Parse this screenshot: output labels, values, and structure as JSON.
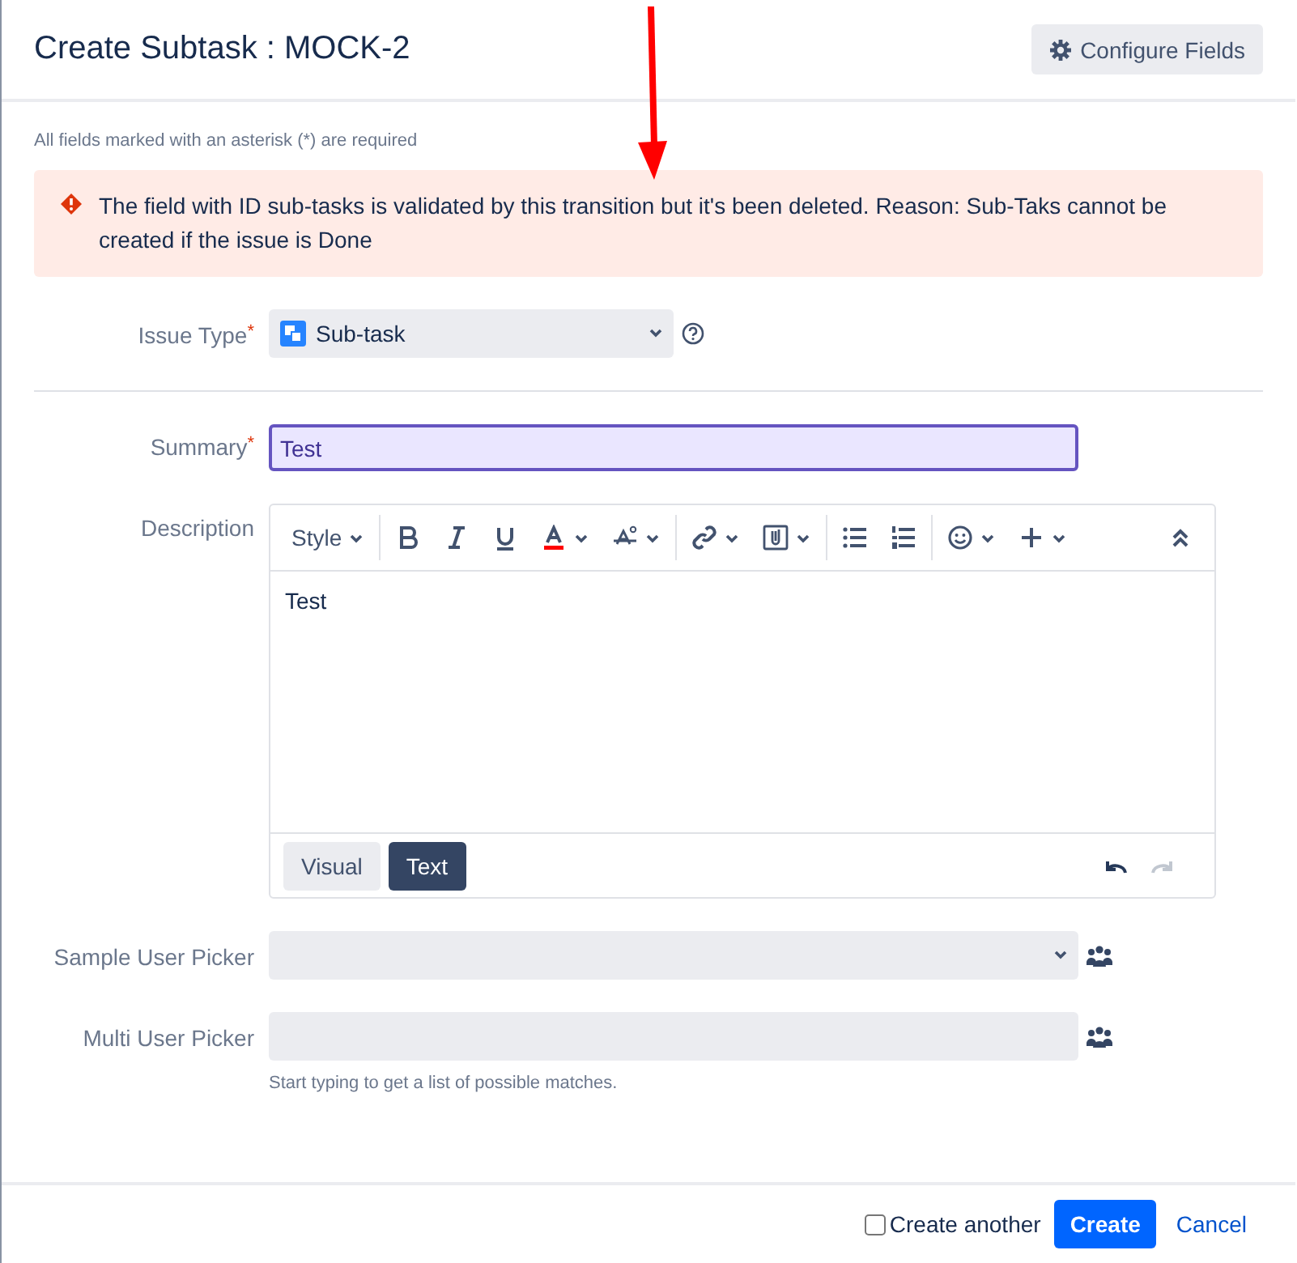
{
  "dialog": {
    "title": "Create Subtask : MOCK-2",
    "configure_button": "Configure Fields"
  },
  "required_note": "All fields marked with an asterisk (*) are required",
  "error": {
    "message": "The field with ID sub-tasks is validated by this transition but it's been deleted. Reason: Sub-Taks cannot be created if the issue is Done"
  },
  "issue_type": {
    "label": "Issue Type",
    "required_mark": "*",
    "value": "Sub-task"
  },
  "summary": {
    "label": "Summary",
    "required_mark": "*",
    "value": "Test"
  },
  "description": {
    "label": "Description",
    "style_menu": "Style",
    "value": "Test",
    "modes": [
      {
        "label": "Visual",
        "selected": false
      },
      {
        "label": "Text",
        "selected": true
      }
    ],
    "undo": {
      "disabled": false
    },
    "redo": {
      "disabled": true
    }
  },
  "sample_user_picker": {
    "label": "Sample User Picker"
  },
  "multi_user_picker": {
    "label": "Multi User Picker",
    "hint": "Start typing to get a list of possible matches."
  },
  "footer": {
    "create_another": {
      "label": "Create another",
      "checked": false
    },
    "create_button": "Create",
    "cancel_link": "Cancel"
  }
}
